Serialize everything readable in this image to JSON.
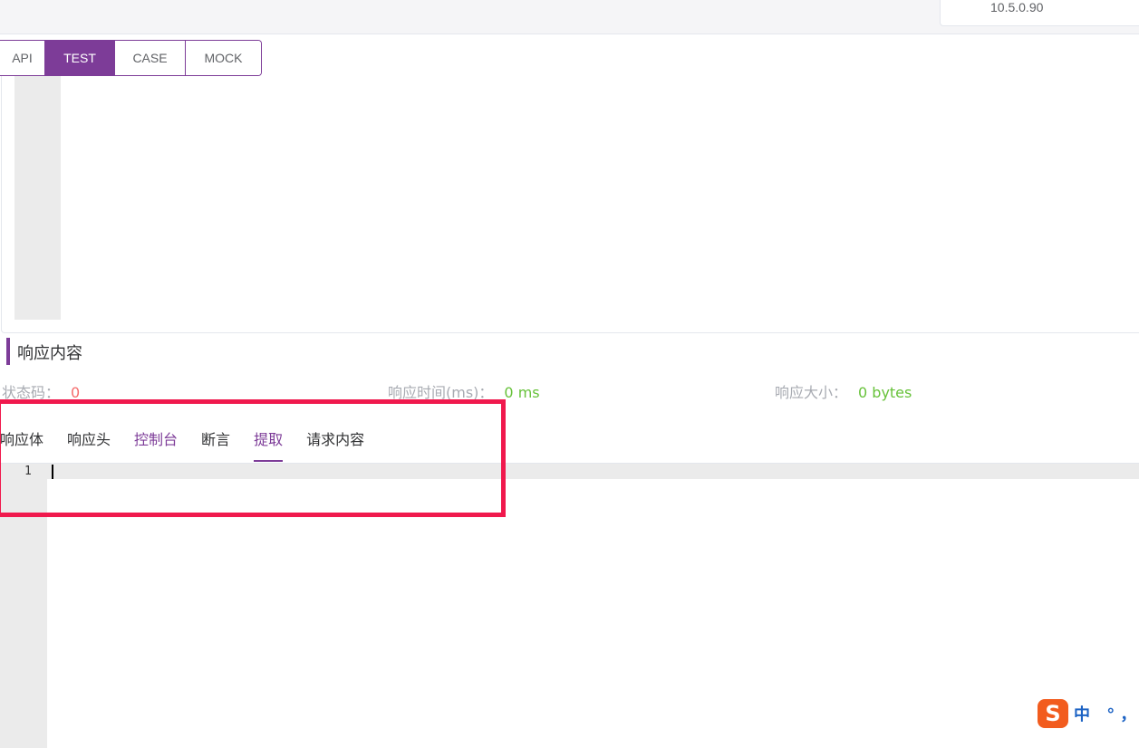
{
  "header": {
    "ip_address": "10.5.0.90"
  },
  "mode_tabs": [
    {
      "label": "API",
      "active": false
    },
    {
      "label": "TEST",
      "active": true
    },
    {
      "label": "CASE",
      "active": false
    },
    {
      "label": "MOCK",
      "active": false
    }
  ],
  "response_section": {
    "title": "响应内容",
    "status_code_label": "状态码：",
    "status_code_value": "0",
    "response_time_label": "响应时间(ms)：",
    "response_time_value": "0 ms",
    "response_size_label": "响应大小：",
    "response_size_value": "0 bytes"
  },
  "response_tabs": [
    {
      "label": "响应体"
    },
    {
      "label": "响应头"
    },
    {
      "label": "控制台"
    },
    {
      "label": "断言"
    },
    {
      "label": "提取"
    },
    {
      "label": "请求内容"
    }
  ],
  "response_editor": {
    "line_number": "1"
  },
  "ime": {
    "logo": "S",
    "text": "中 °，拼"
  },
  "colors": {
    "accent": "#7d3c98",
    "status_error": "#f56c6c",
    "status_ok": "#67c23a",
    "highlight": "#f0194d"
  }
}
